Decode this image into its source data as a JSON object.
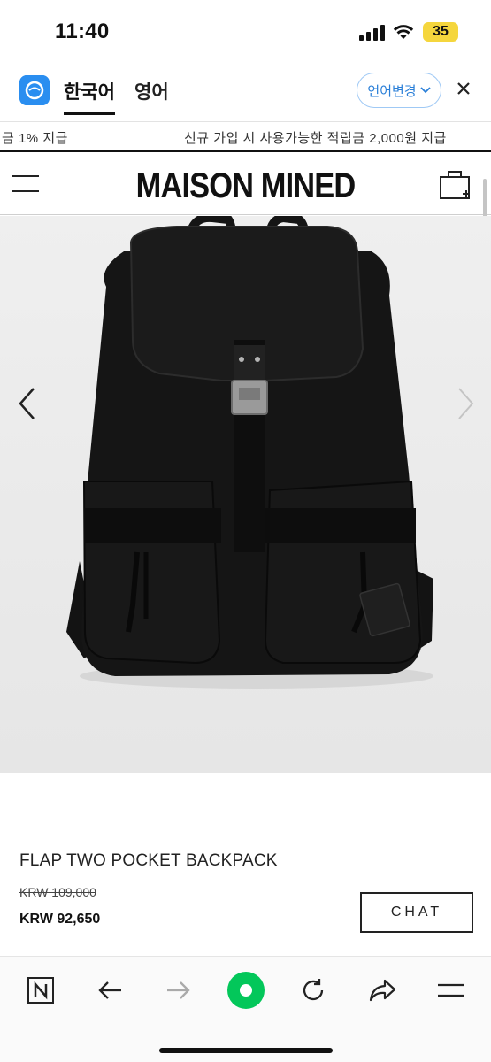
{
  "status_bar": {
    "time": "11:40",
    "battery": "35",
    "battery_color": "#f5d63d"
  },
  "translate_bar": {
    "tabs": [
      {
        "label": "한국어",
        "active": true
      },
      {
        "label": "영어",
        "active": false
      }
    ],
    "change_language_label": "언어변경",
    "accent_color": "#2a8ef0"
  },
  "ticker": {
    "left_text": "금 1% 지급",
    "right_text": "신규 가입 시 사용가능한 적립금 2,000원 지급"
  },
  "header": {
    "brand": "MAISON MINED",
    "menu_icon": "hamburger-icon",
    "cart_icon": "cart-icon"
  },
  "product": {
    "name": "FLAP TWO POCKET BACKPACK",
    "original_price": "KRW 109,000",
    "sale_price": "KRW 92,650",
    "chat_label": "CHAT",
    "image_subject": "black backpack"
  },
  "bottom_bar": {
    "icons": [
      "naver-n-icon",
      "back-arrow-icon",
      "forward-arrow-icon",
      "green-circle-icon",
      "reload-icon",
      "share-icon",
      "menu-icon"
    ],
    "green_color": "#03c75a"
  }
}
